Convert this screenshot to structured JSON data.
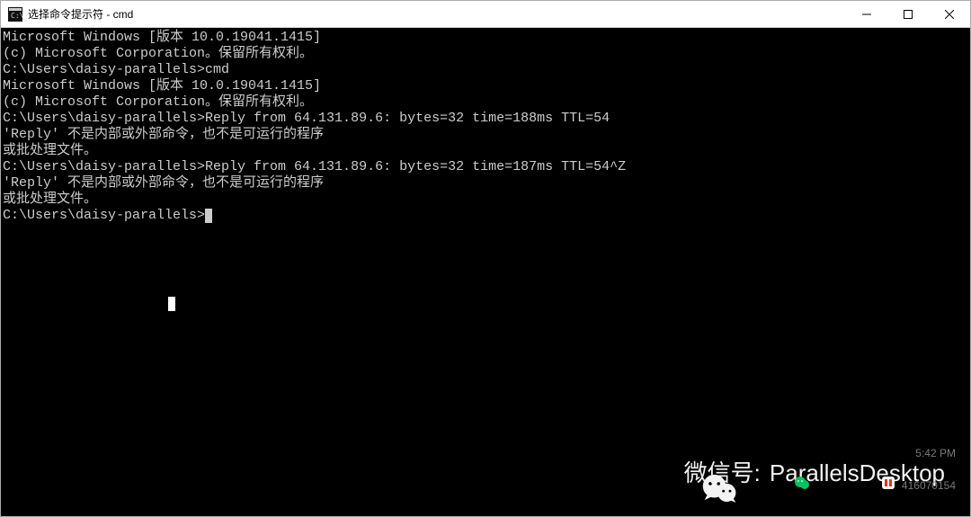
{
  "window": {
    "title": "选择命令提示符 - cmd"
  },
  "terminal": {
    "lines": [
      "Microsoft Windows [版本 10.0.19041.1415]",
      "(c) Microsoft Corporation。保留所有权利。",
      "",
      "C:\\Users\\daisy-parallels>cmd",
      "Microsoft Windows [版本 10.0.19041.1415]",
      "(c) Microsoft Corporation。保留所有权利。",
      "",
      "C:\\Users\\daisy-parallels>Reply from 64.131.89.6: bytes=32 time=188ms TTL=54",
      "'Reply' 不是内部或外部命令，也不是可运行的程序",
      "或批处理文件。",
      "",
      "C:\\Users\\daisy-parallels>Reply from 64.131.89.6: bytes=32 time=187ms TTL=54^Z",
      "'Reply' 不是内部或外部命令，也不是可运行的程序",
      "或批处理文件。",
      "",
      "C:\\Users\\daisy-parallels>"
    ],
    "prompt_has_cursor": true
  },
  "watermark": {
    "label": "微信号:",
    "value": "ParallelsDesktop"
  },
  "tray": {
    "line1": "5:42 PM",
    "line2": "416070154"
  }
}
